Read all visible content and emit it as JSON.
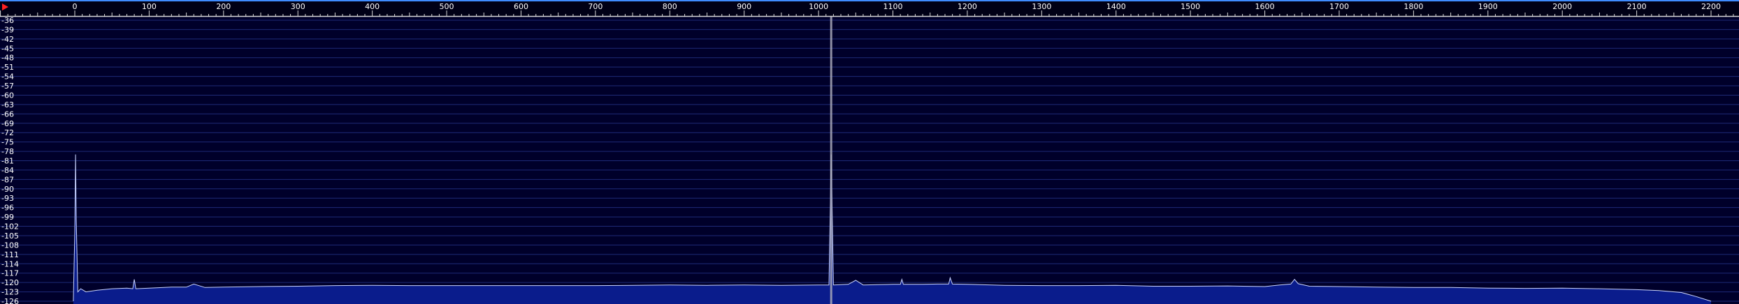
{
  "colors": {
    "background": "#00002a",
    "gridline": "#1e2a78",
    "ruler_background": "#000016",
    "ruler_line": "#d8d8d8",
    "text": "#ffffff",
    "spectrum_fill": "#0a1c8c",
    "spectrum_trace": "#c9d4ff",
    "marker_line": "#a8a8b8",
    "top_edge_indicator": "#3f8cff",
    "corner_marker": "#ff2020"
  },
  "markers": {
    "corner_marker_icon": "red-triangle-icon",
    "tuning_marker_frequency": 1017
  },
  "chart_data": {
    "type": "line",
    "title": "",
    "xlabel": "",
    "ylabel": "",
    "xlim": [
      -100,
      2240
    ],
    "ylim": [
      -126,
      -36
    ],
    "grid": true,
    "x_ticks": [
      "0",
      "100",
      "200",
      "300",
      "400",
      "500",
      "600",
      "700",
      "800",
      "900",
      "1000",
      "1100",
      "1200",
      "1300",
      "1400",
      "1500",
      "1600",
      "1700",
      "1800",
      "1900",
      "2000",
      "2100",
      "2200"
    ],
    "y_ticks": [
      "-36",
      "-39",
      "-42",
      "-45",
      "-48",
      "-51",
      "-54",
      "-57",
      "-60",
      "-63",
      "-66",
      "-69",
      "-72",
      "-75",
      "-78",
      "-81",
      "-84",
      "-87",
      "-90",
      "-93",
      "-96",
      "-99",
      "-102",
      "-105",
      "-108",
      "-111",
      "-114",
      "-117",
      "-120",
      "-123",
      "-126"
    ],
    "series": [
      {
        "x": [
          -2,
          0,
          1,
          2,
          4,
          8,
          15,
          30,
          50,
          70,
          78,
          80,
          82,
          100,
          130,
          150,
          160,
          175,
          200,
          250,
          300,
          350,
          400,
          450,
          500,
          550,
          600,
          650,
          700,
          750,
          800,
          850,
          900,
          950,
          1000,
          1014,
          1017,
          1020,
          1040,
          1050,
          1060,
          1080,
          1100,
          1110,
          1112,
          1114,
          1140,
          1160,
          1175,
          1177,
          1180,
          1200,
          1250,
          1300,
          1350,
          1400,
          1450,
          1500,
          1550,
          1600,
          1620,
          1635,
          1640,
          1645,
          1660,
          1700,
          1750,
          1800,
          1850,
          1900,
          1950,
          2000,
          2050,
          2100,
          2130,
          2160,
          2180,
          2200
        ],
        "y": [
          -126,
          -104,
          -79,
          -100,
          -123,
          -122,
          -123,
          -122.5,
          -122,
          -121.8,
          -122,
          -119,
          -122,
          -121.8,
          -121.5,
          -121.5,
          -120.5,
          -121.6,
          -121.5,
          -121.3,
          -121.2,
          -121,
          -120.9,
          -121,
          -121,
          -121,
          -121,
          -121,
          -121,
          -120.9,
          -120.8,
          -120.9,
          -120.8,
          -120.9,
          -120.8,
          -120.8,
          -79,
          -120.8,
          -120.6,
          -119.3,
          -120.8,
          -120.7,
          -120.6,
          -120.6,
          -119,
          -120.6,
          -120.6,
          -120.5,
          -120.5,
          -118.5,
          -120.5,
          -120.6,
          -120.9,
          -121,
          -121,
          -120.9,
          -121.2,
          -121.2,
          -121.1,
          -121.3,
          -120.8,
          -120.5,
          -119,
          -120.4,
          -121.2,
          -121.3,
          -121.5,
          -121.6,
          -121.6,
          -121.8,
          -121.9,
          -121.8,
          -122,
          -122.3,
          -122.6,
          -123.2,
          -124.5,
          -126
        ]
      }
    ]
  }
}
